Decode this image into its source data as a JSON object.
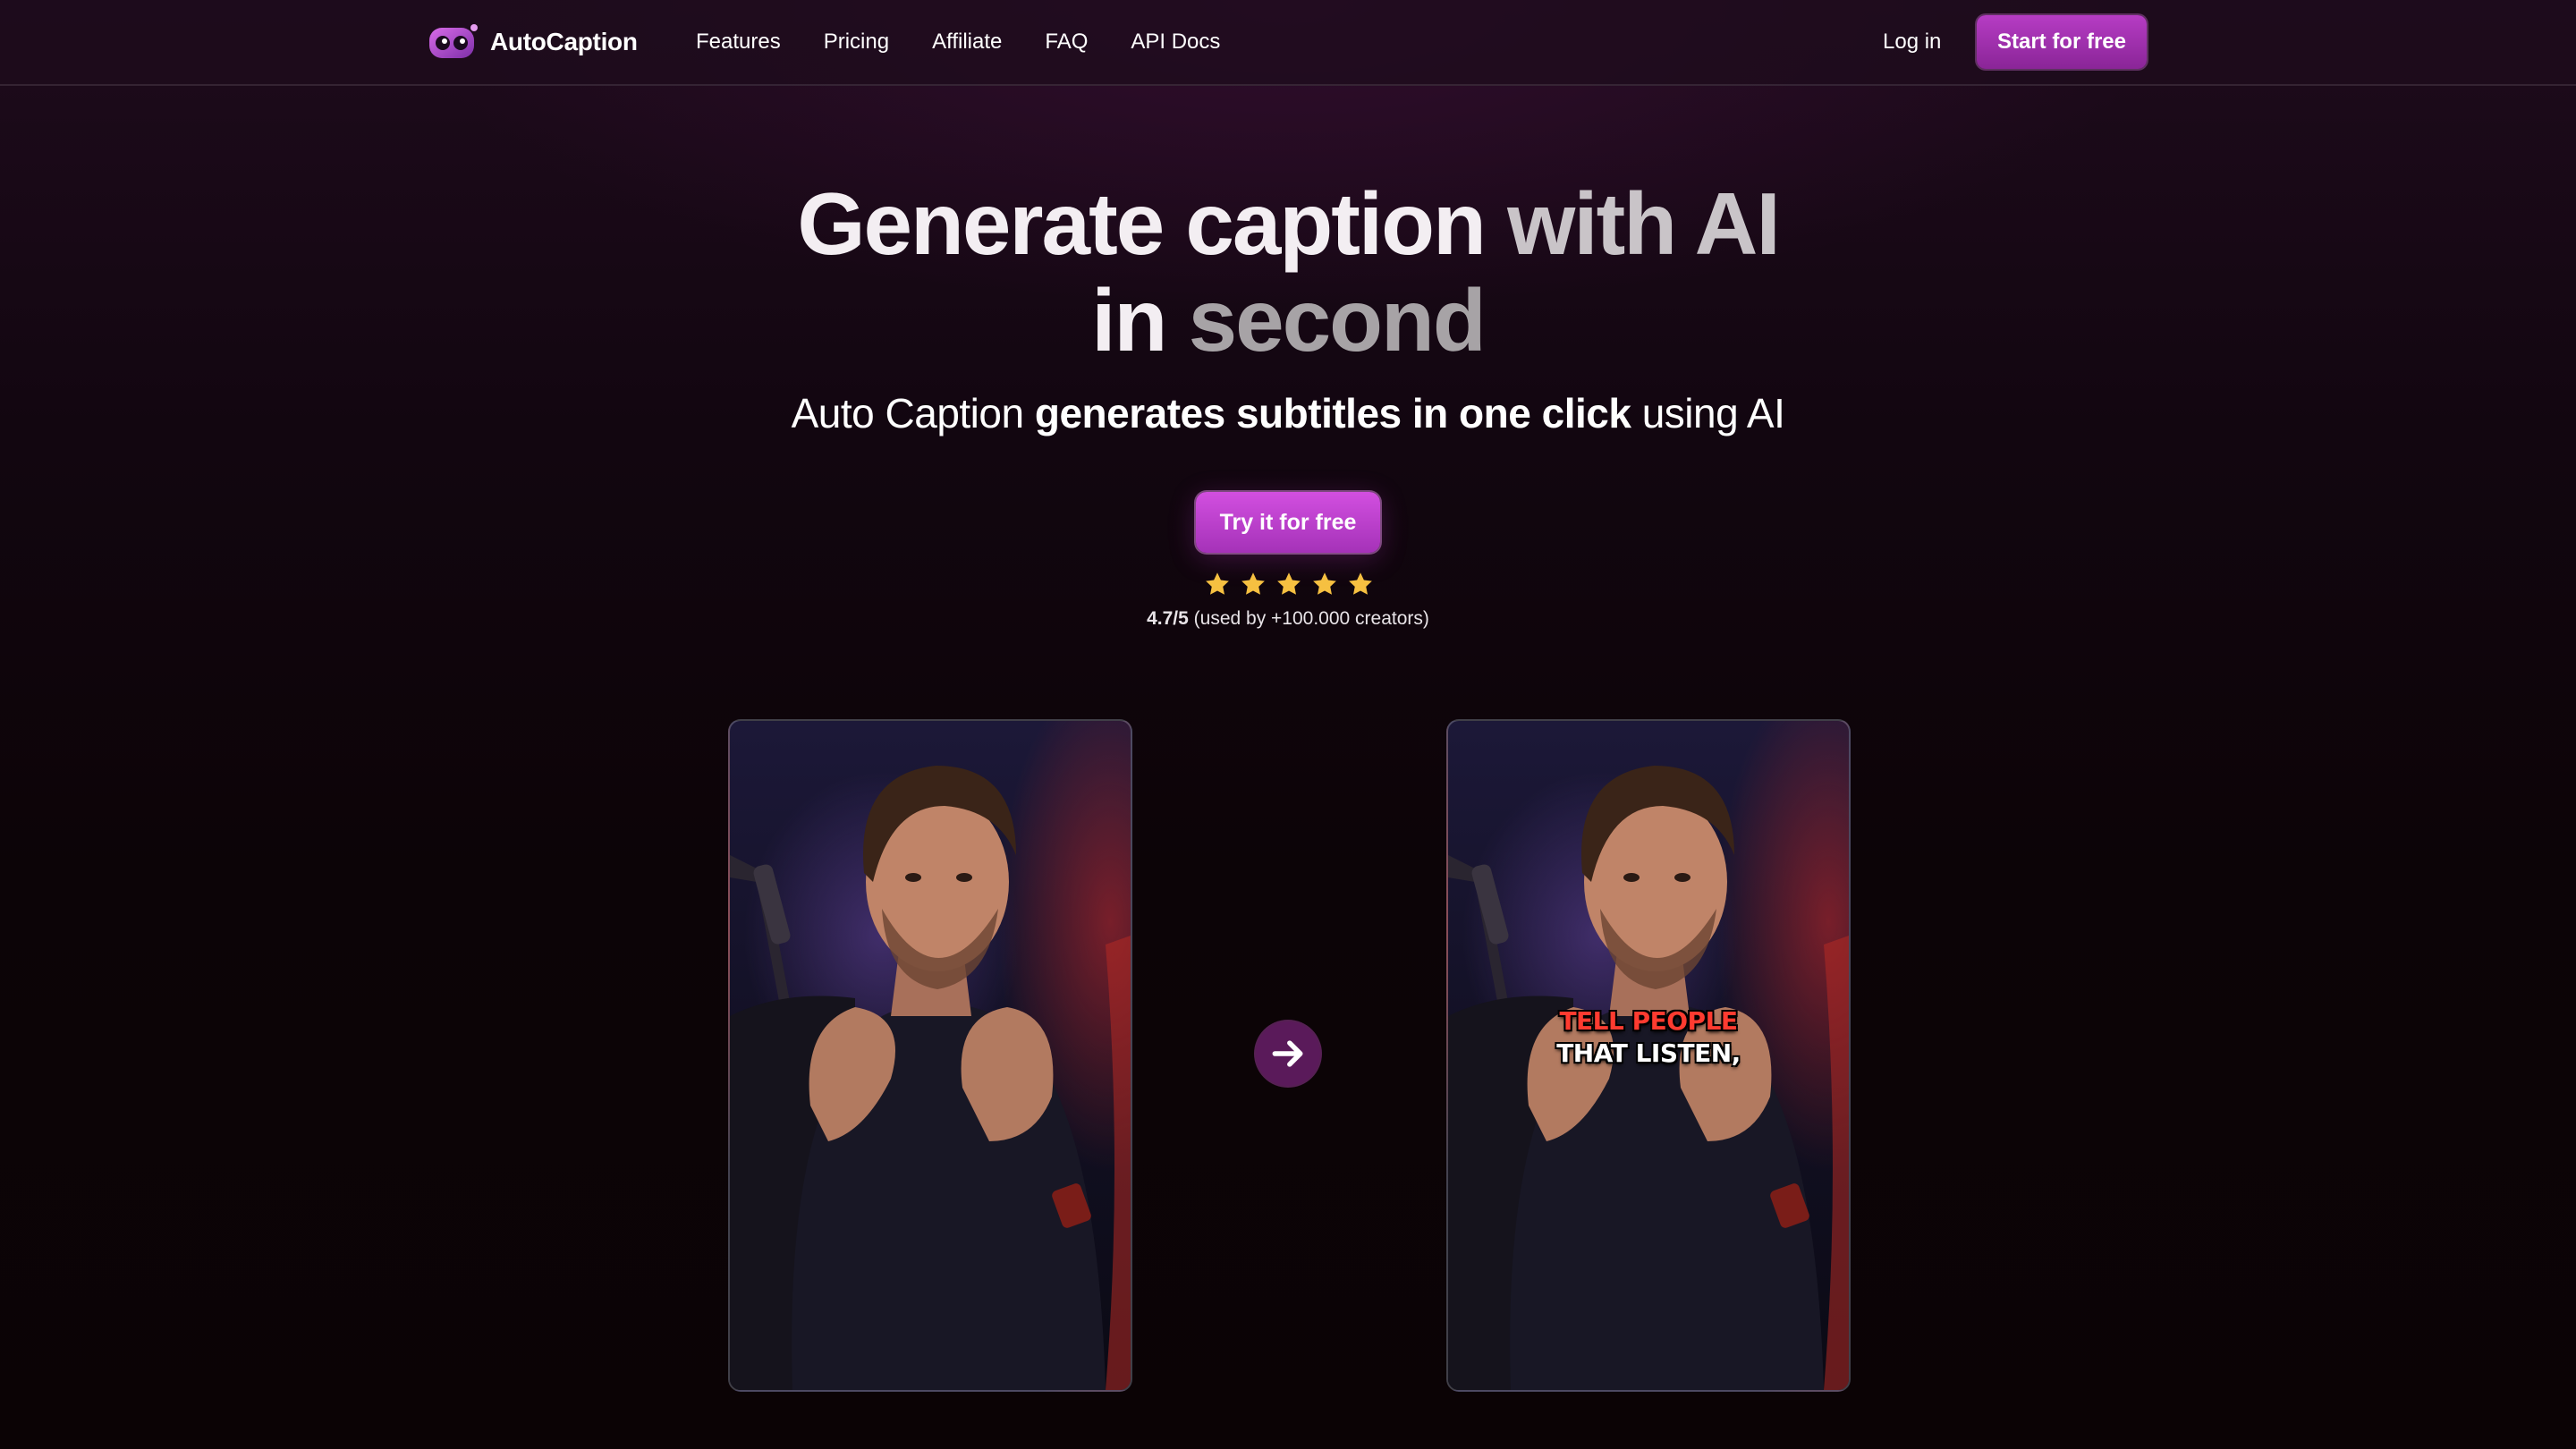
{
  "brand": {
    "name": "AutoCaption",
    "icon": "robot-mascot-icon",
    "accent": "#b63cc4"
  },
  "nav": {
    "links": [
      "Features",
      "Pricing",
      "Affiliate",
      "FAQ",
      "API Docs"
    ],
    "login": "Log in",
    "cta": "Start for free"
  },
  "hero": {
    "headline_part1": "Generate caption ",
    "headline_part2": "with AI",
    "headline_part3": "in ",
    "headline_part4": "second",
    "sub_part1": "Auto Caption ",
    "sub_bold": "generates subtitles in one click",
    "sub_part2": " using AI",
    "cta": "Try it for free",
    "stars": 5,
    "rating_value": "4.7/5",
    "rating_text": " (used by +100.000 creators)"
  },
  "demo": {
    "caption_line1": "TELL PEOPLE",
    "caption_line2": "THAT LISTEN,",
    "arrow_icon": "arrow-right-icon"
  }
}
